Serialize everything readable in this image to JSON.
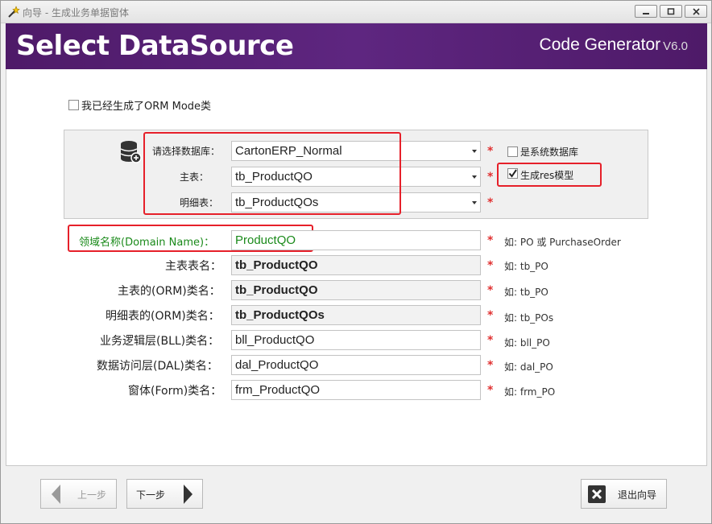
{
  "window": {
    "title": "向导 - 生成业务单据窗体"
  },
  "banner": {
    "title": "Select DataSource",
    "brand": "Code Generator",
    "version": "V6.0"
  },
  "form": {
    "orm_checkbox_label": "我已经生成了ORM Mode类",
    "database_label": "请选择数据库：",
    "database_value": "CartonERP_Normal",
    "main_table_label": "主表：",
    "main_table_value": "tb_ProductQO",
    "detail_table_label": "明细表：",
    "detail_table_value": "tb_ProductQOs",
    "system_db_label": "是系统数据库",
    "gen_res_label": "生成res模型",
    "domain_label": "领域名称(Domain Name)：",
    "domain_value": "ProductQO",
    "domain_hint": "如: PO 或 PurchaseOrder",
    "main_table_name_label": "主表表名：",
    "main_table_name_value": "tb_ProductQO",
    "main_table_name_hint": "如: tb_PO",
    "main_orm_label": "主表的(ORM)类名：",
    "main_orm_value": "tb_ProductQO",
    "main_orm_hint": "如: tb_PO",
    "detail_orm_label": "明细表的(ORM)类名：",
    "detail_orm_value": "tb_ProductQOs",
    "detail_orm_hint": "如: tb_POs",
    "bll_label": "业务逻辑层(BLL)类名：",
    "bll_value": "bll_ProductQO",
    "bll_hint": "如: bll_PO",
    "dal_label": "数据访问层(DAL)类名：",
    "dal_value": "dal_ProductQO",
    "dal_hint": "如: dal_PO",
    "form_label": "窗体(Form)类名：",
    "form_value": "frm_ProductQO",
    "form_hint": "如: frm_PO",
    "required_mark": "*"
  },
  "buttons": {
    "prev": "上一步",
    "next": "下一步",
    "exit": "退出向导"
  },
  "colors": {
    "banner": "#5a2478",
    "highlight": "#e6202a",
    "domain_text": "#1a8a1a"
  }
}
